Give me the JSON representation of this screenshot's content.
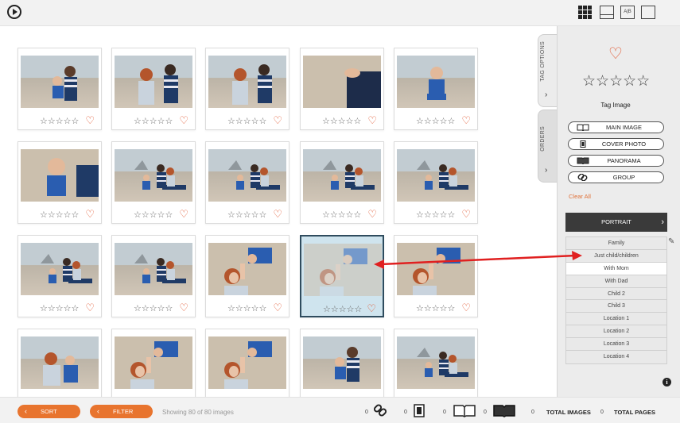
{
  "toolbar": {
    "play_icon": "play-circle-icon",
    "views": [
      {
        "name": "grid-view-icon"
      },
      {
        "name": "spread-view-icon"
      },
      {
        "name": "ab-compare-icon",
        "text": "A|B"
      },
      {
        "name": "single-view-icon"
      }
    ]
  },
  "photos": [
    {
      "stars": "☆☆☆☆☆",
      "heart": "♡",
      "scene": "dad-son"
    },
    {
      "stars": "☆☆☆☆☆",
      "heart": "♡",
      "scene": "mom-dad"
    },
    {
      "stars": "☆☆☆☆☆",
      "heart": "♡",
      "scene": "mom-dad"
    },
    {
      "stars": "☆☆☆☆☆",
      "heart": "♡",
      "scene": "hands-close"
    },
    {
      "stars": "☆☆☆☆☆",
      "heart": "♡",
      "scene": "child"
    },
    {
      "stars": "☆☆☆☆☆",
      "heart": "♡",
      "scene": "child-close"
    },
    {
      "stars": "☆☆☆☆☆",
      "heart": "♡",
      "scene": "family"
    },
    {
      "stars": "☆☆☆☆☆",
      "heart": "♡",
      "scene": "family"
    },
    {
      "stars": "☆☆☆☆☆",
      "heart": "♡",
      "scene": "family"
    },
    {
      "stars": "☆☆☆☆☆",
      "heart": "♡",
      "scene": "family"
    },
    {
      "stars": "☆☆☆☆☆",
      "heart": "♡",
      "scene": "family"
    },
    {
      "stars": "☆☆☆☆☆",
      "heart": "♡",
      "scene": "family"
    },
    {
      "stars": "☆☆☆☆☆",
      "heart": "♡",
      "scene": "mom-lift"
    },
    {
      "stars": "☆☆☆☆☆",
      "heart": "♡",
      "scene": "mom-lift",
      "selected": true
    },
    {
      "stars": "☆☆☆☆☆",
      "heart": "♡",
      "scene": "mom-lift"
    },
    {
      "stars": "☆☆☆☆☆",
      "heart": "♡",
      "scene": "mom-child"
    },
    {
      "stars": "☆☆☆☆☆",
      "heart": "♡",
      "scene": "mom-lift"
    },
    {
      "stars": "☆☆☆☆☆",
      "heart": "♡",
      "scene": "mom-lift"
    },
    {
      "stars": "☆☆☆☆☆",
      "heart": "♡",
      "scene": "dad-son"
    },
    {
      "stars": "☆☆☆☆☆",
      "heart": "♡",
      "scene": "family"
    }
  ],
  "side_tabs": {
    "tag_options": "TAG OPTIONS",
    "orders": "ORDERS",
    "chevron": "›"
  },
  "panel": {
    "heart": "♡",
    "stars": "☆☆☆☆☆",
    "tag_image": "Tag Image",
    "buttons": [
      {
        "label": "MAIN IMAGE",
        "icon": "open-book-icon"
      },
      {
        "label": "COVER PHOTO",
        "icon": "cover-photo-icon"
      },
      {
        "label": "PANORAMA",
        "icon": "panorama-icon"
      },
      {
        "label": "GROUP",
        "icon": "link-icon"
      }
    ],
    "clear_all": "Clear All",
    "portrait": "PORTRAIT",
    "portrait_chevron": "›",
    "tags": [
      "Family",
      "Just child/children",
      "With Mom",
      "With Dad",
      "Child 2",
      "Child 3",
      "Location 1",
      "Location 2",
      "Location 3",
      "Location 4"
    ],
    "active_tag": "With Mom",
    "pencil": "✎",
    "info": "i"
  },
  "bottom": {
    "sort": "SORT",
    "filter": "FILTER",
    "chevron": "‹",
    "showing": "Showing 80 of 80 images",
    "counts": [
      "0",
      "0",
      "0",
      "0",
      "0",
      "0"
    ],
    "total_images": "TOTAL IMAGES",
    "total_pages": "TOTAL PAGES"
  },
  "colors": {
    "accent": "#e8742e",
    "heart": "#e0522a",
    "arrow": "#e02020",
    "selected_border": "#2f4c5e"
  }
}
